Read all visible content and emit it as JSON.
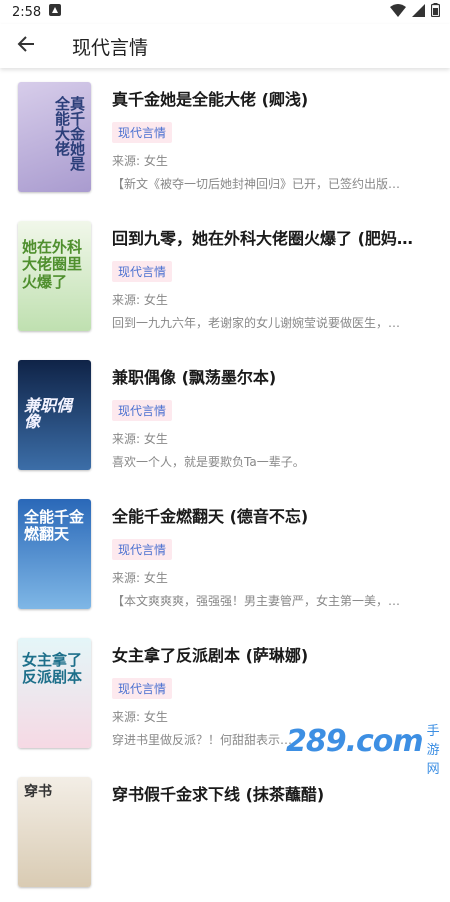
{
  "status": {
    "time": "2:58"
  },
  "header": {
    "title": "现代言情"
  },
  "books": [
    {
      "title": "真千金她是全能大佬 (卿浅)",
      "tag": "现代言情",
      "source": "来源: 女生",
      "desc": "【新文《被夺一切后她封神回归》已开，已签约出版…",
      "cover_text": "真千金她是全能大佬",
      "cover_color": "#b7a9d4"
    },
    {
      "title": "回到九零，她在外科大佬圈火爆了 (肥妈向…",
      "tag": "现代言情",
      "source": "来源: 女生",
      "desc": "回到一九九六年，老谢家的女儿谢婉莹说要做医生，…",
      "cover_text": "她在外科大佬圈里火爆了",
      "cover_color": "#d9ecd0"
    },
    {
      "title": "兼职偶像 (飘荡墨尔本)",
      "tag": "现代言情",
      "source": "来源: 女生",
      "desc": "喜欢一个人，就是要欺负Ta一辈子。",
      "cover_text": "兼职偶像",
      "cover_color": "#1e3a66"
    },
    {
      "title": "全能千金燃翻天 (德音不忘)",
      "tag": "现代言情",
      "source": "来源: 女生",
      "desc": "【本文爽爽爽，强强强！男主妻管严，女主第一美，…",
      "cover_text": "全能千金燃翻天",
      "cover_color": "#3a7fc8"
    },
    {
      "title": "女主拿了反派剧本 (萨琳娜)",
      "tag": "现代言情",
      "source": "来源: 女生",
      "desc": "穿进书里做反派？！何甜甜表示…",
      "cover_text": "女主拿了反派剧本",
      "cover_color": "#d6f0f4"
    },
    {
      "title": "穿书假千金求下线 (抹茶蘸醋)",
      "tag": "",
      "source": "",
      "desc": "",
      "cover_text": "穿书",
      "cover_color": "#efe9e0"
    }
  ],
  "watermark": {
    "main": "289.com",
    "sub": "手游网"
  }
}
